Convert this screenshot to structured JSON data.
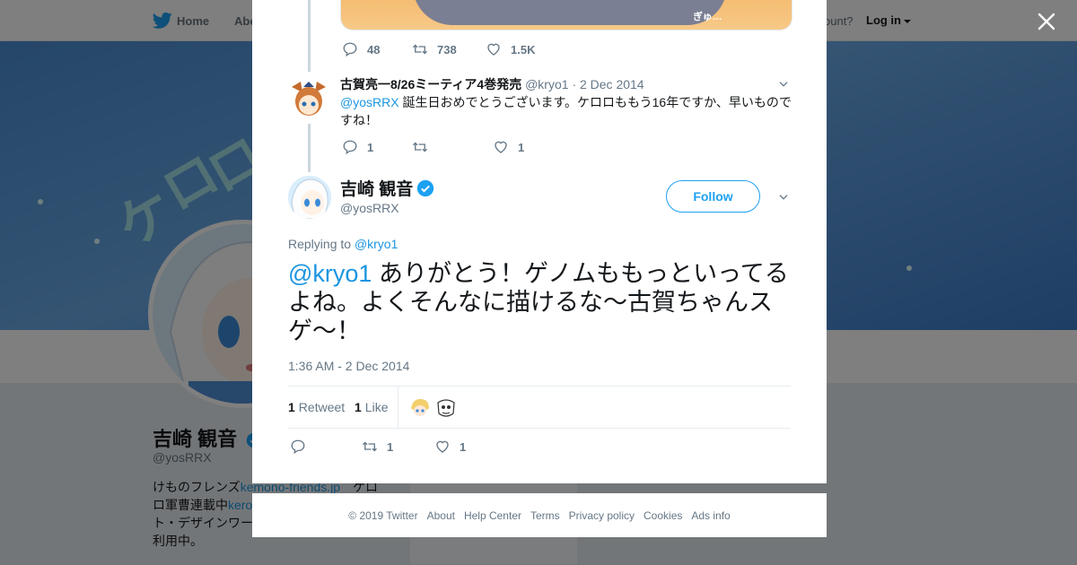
{
  "topnav": {
    "home": "Home",
    "about": "Abo",
    "account_prompt": "ccount?",
    "login": "Log in"
  },
  "banner": {
    "deco_chars": [
      "ケ",
      "ロ",
      "ロ"
    ]
  },
  "profile": {
    "name": "吉崎 観音",
    "handle": "@yosRRX",
    "bio_parts": [
      "けものフレンズ",
      "kemono-friends.jp",
      "　ケロ",
      "ロ軍曹連載中",
      "kero",
      "ト・デザインワー",
      "利用中。"
    ],
    "ads_snippet": "Ads info"
  },
  "previous_tweet": {
    "replies": "48",
    "retweets": "738",
    "likes": "1.5K"
  },
  "reply_tweet": {
    "name": "古賀亮一8/26ミーティア4巻発売",
    "handle": "@kryo1",
    "date": "· 2 Dec 2014",
    "mention": "@yosRRX",
    "text": " 誕生日おめでとうございます。ケロロももう16年ですか、早いものですね！",
    "replies": "1",
    "retweets": "",
    "likes": "1"
  },
  "main_tweet": {
    "name": "吉崎 観音",
    "handle": "@yosRRX",
    "follow_label": "Follow",
    "replying_to_label": "Replying to ",
    "replying_to_handle": "@kryo1",
    "mention": "@kryo1",
    "text": " ありがとう！ゲノムももっといってるよね。よくそんなに描けるな〜古賀ちゃんスゲ〜！",
    "timestamp": "1:36 AM - 2 Dec 2014",
    "retweet_count": "1",
    "retweet_label": "Retweet",
    "like_count": "1",
    "like_label": "Like",
    "action_replies": "",
    "action_retweets": "1",
    "action_likes": "1"
  },
  "footer": {
    "links": [
      "© 2019 Twitter",
      "About",
      "Help Center",
      "Terms",
      "Privacy policy",
      "Cookies",
      "Ads info"
    ]
  },
  "colors": {
    "accent": "#1da1f2",
    "link": "#1b95e0",
    "verified": "#1da1f2",
    "overlay": "rgba(0,0,0,0.5)"
  }
}
